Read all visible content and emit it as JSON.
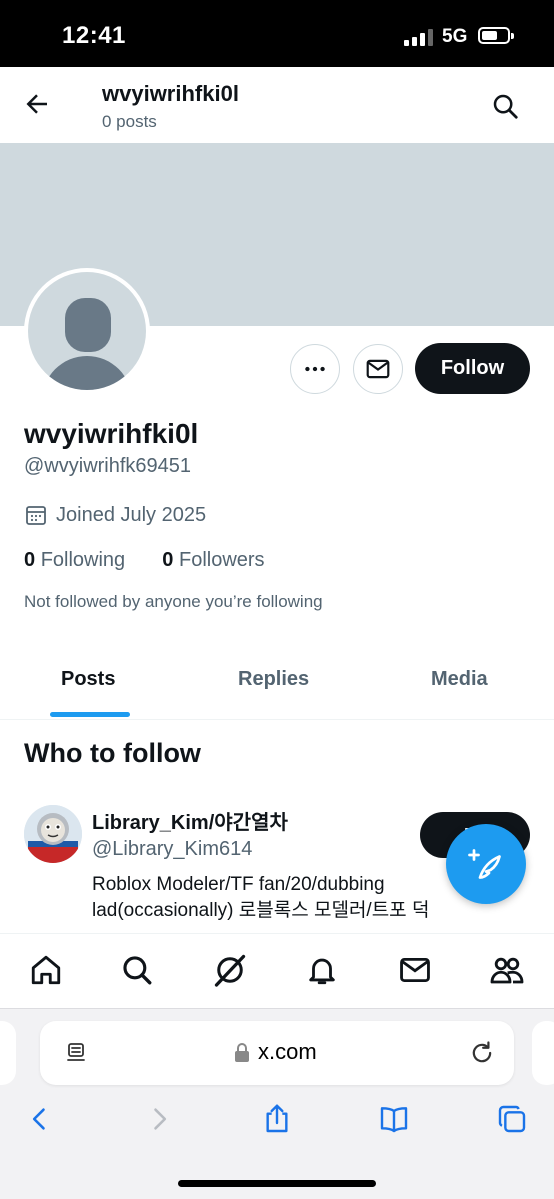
{
  "status_bar": {
    "time": "12:41",
    "network": "5G"
  },
  "header": {
    "name": "wvyiwrihfki0l",
    "posts_count": "0 posts"
  },
  "profile": {
    "display_name": "wvyiwrihfki0l",
    "handle": "@wvyiwrihfk69451",
    "joined": "Joined July 2025",
    "following_count": "0",
    "following_label": "Following",
    "followers_count": "0",
    "followers_label": "Followers",
    "not_followed": "Not followed by anyone you’re following",
    "follow_label": "Follow"
  },
  "tabs": [
    {
      "label": "Posts",
      "active": true
    },
    {
      "label": "Replies",
      "active": false
    },
    {
      "label": "Media",
      "active": false
    }
  ],
  "who_to_follow": {
    "title": "Who to follow",
    "suggestion": {
      "name": "Library_Kim/야간열차",
      "handle": "@Library_Kim614",
      "bio": "Roblox Modeler/TF fan/20/dubbing lad(occasionally) 로블록스 모델러/트포 덕",
      "follow_label": "Fo"
    }
  },
  "bottom_nav": [
    "home-icon",
    "explore-icon",
    "grok-icon",
    "notifications-icon",
    "messages-icon",
    "communities-icon"
  ],
  "browser": {
    "url": "x.com"
  },
  "colors": {
    "accent": "#1d9bf0",
    "text": "#0f1419",
    "secondary": "#536471",
    "banner": "#cfd9de"
  }
}
